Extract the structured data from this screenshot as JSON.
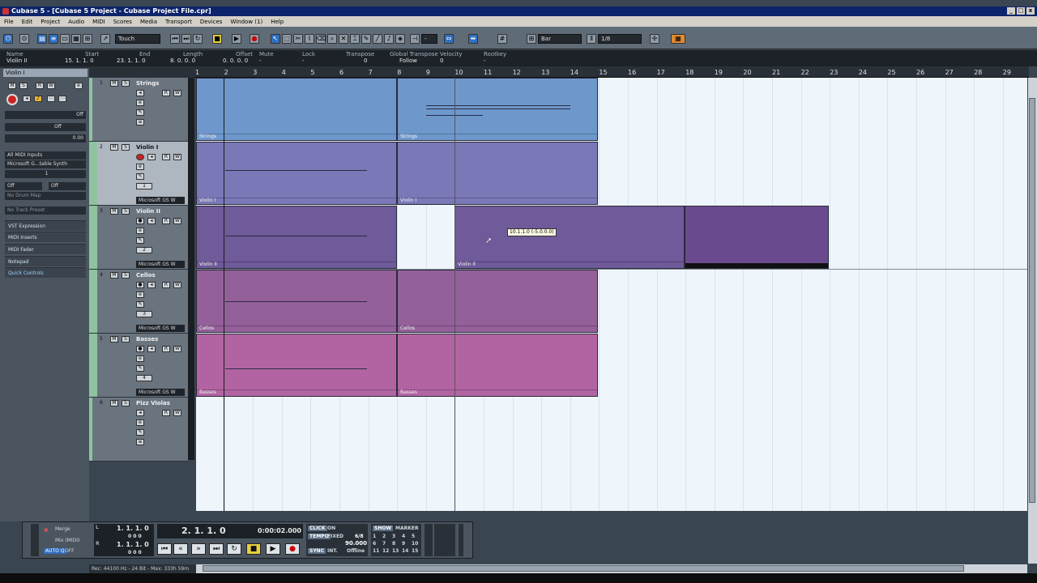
{
  "window": {
    "title": "Cubase 5 - [Cubase 5 Project - Cubase Project File.cpr]",
    "controls": [
      "_",
      "□",
      "x"
    ]
  },
  "menu": [
    "File",
    "Edit",
    "Project",
    "Audio",
    "MIDI",
    "Scores",
    "Media",
    "Transport",
    "Devices",
    "Window (1)",
    "Help"
  ],
  "toolbar": {
    "automation_mode": "Touch",
    "grid_type": "Bar",
    "quantize": "1/8",
    "dash": "-"
  },
  "infoline": {
    "columns": [
      {
        "label": "Name",
        "value": "Violin II"
      },
      {
        "label": "Start",
        "value": "15. 1. 1.  0"
      },
      {
        "label": "End",
        "value": "23. 1. 1.  0"
      },
      {
        "label": "Length",
        "value": "8. 0. 0.  0"
      },
      {
        "label": "Offset",
        "value": "0. 0. 0.  0"
      },
      {
        "label": "Mute",
        "value": "-"
      },
      {
        "label": "Lock",
        "value": "-"
      },
      {
        "label": "Transpose",
        "value": "0"
      },
      {
        "label": "Global Transpose",
        "value": "Follow"
      },
      {
        "label": "Velocity",
        "value": "0"
      },
      {
        "label": "Rootkey",
        "value": "-"
      }
    ]
  },
  "ruler": [
    "1",
    "2",
    "3",
    "4",
    "5",
    "6",
    "7",
    "8",
    "9",
    "10",
    "11",
    "12",
    "13",
    "14",
    "15",
    "16",
    "17",
    "18",
    "19",
    "20",
    "21",
    "22",
    "23",
    "24",
    "25",
    "26",
    "27",
    "28",
    "29"
  ],
  "inspector": {
    "track_name": "Violin I",
    "rows": [
      {
        "text": "Off"
      },
      {
        "text": "Off"
      },
      {
        "text": "0.00"
      },
      {
        "text": "All MIDI Inputs"
      },
      {
        "text": "Microsoft G...table Synth"
      },
      {
        "text": "1"
      },
      {
        "text": "Off"
      },
      {
        "text": "Off"
      },
      {
        "text": "No Drum Map"
      },
      {
        "text": "No Track Preset"
      }
    ],
    "sections": [
      "VST Expression",
      "MIDI Inserts",
      "MIDI Fader",
      "Notepad",
      "Quick Controls"
    ]
  },
  "tracks": [
    {
      "num": "1",
      "name": "Strings",
      "selected": false,
      "device": ""
    },
    {
      "num": "2",
      "name": "Violin I",
      "selected": true,
      "device": "Microsoft GS W"
    },
    {
      "num": "3",
      "name": "Violin II",
      "selected": false,
      "device": "Microsoft GS W"
    },
    {
      "num": "4",
      "name": "Cellos",
      "selected": false,
      "device": "Microsoft GS W"
    },
    {
      "num": "5",
      "name": "Basses",
      "selected": false,
      "device": "Microsoft GS W"
    },
    {
      "num": "6",
      "name": "Pizz Violas",
      "selected": false,
      "device": ""
    }
  ],
  "track_channels": [
    "",
    "1",
    "2",
    "3",
    "4",
    ""
  ],
  "parts": {
    "strings_a": "Strings",
    "strings_b": "Strings",
    "violin1_a": "Violin I",
    "violin1_b": "Violin I",
    "violin2_a": "Violin II",
    "violin2_b": "Violin II",
    "cellos_a": "Cellos",
    "cellos_b": "Cellos",
    "basses_a": "Basses",
    "basses_b": "Basses"
  },
  "colors": {
    "strings": "#6e98cc",
    "violin1": "#7b78b8",
    "violin2": "#6f5a9a",
    "cellos": "#93609a",
    "basses": "#b264a2",
    "selected_part": "#6a4a8e"
  },
  "drag_tooltip": "10.1.1.0 (-5.0.0.0)",
  "transport": {
    "merge": "Merge",
    "mix_midi": "Mix (MIDI)",
    "auto_q": "AUTO Q",
    "auto_q_state": "OFF",
    "left_locator": "1.  1.  1.    0",
    "right_locator": "1.  1.  1.    0",
    "loc_sub": "0    0    0",
    "position": "2.  1.  1.    0",
    "time": "0:00:02.000",
    "click": "CLICK",
    "click_state": "ON",
    "tempo_label": "TEMPO",
    "tempo_mode": "FIXED",
    "signature": "6/8",
    "tempo": "90.000",
    "sync": "SYNC",
    "sync_mode": "INT.",
    "offline": "Offline",
    "show": "SHOW",
    "marker": "MARKER",
    "markers": [
      "1",
      "2",
      "3",
      "4",
      "5",
      "6",
      "7",
      "8",
      "9",
      "10",
      "11",
      "12",
      "13",
      "14",
      "15"
    ]
  },
  "status": "Rec: 44100 Hz - 24 Bit - Max: 333h 59m"
}
